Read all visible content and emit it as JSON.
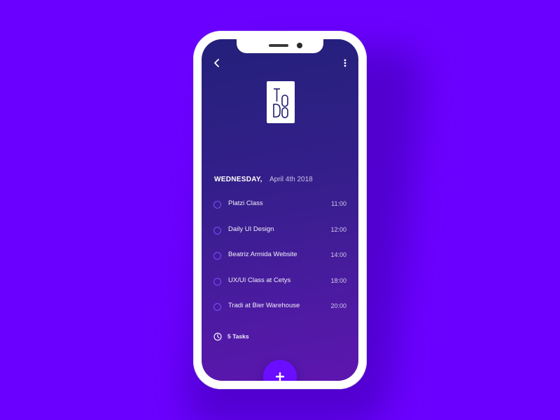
{
  "app": {
    "logo_text": "TODO"
  },
  "header": {
    "day": "WEDNESDAY,",
    "date": "April 4th 2018"
  },
  "tasks": [
    {
      "name": "Platzi Class",
      "time": "11:00"
    },
    {
      "name": "Daily UI Design",
      "time": "12:00"
    },
    {
      "name": "Beatriz Armida Website",
      "time": "14:00"
    },
    {
      "name": "UX/UI Class at Cetys",
      "time": "18:00"
    },
    {
      "name": "Tradi at Bier Warehouse",
      "time": "20:00"
    }
  ],
  "summary": {
    "count_label": "5 Tasks"
  },
  "icons": {
    "back": "chevron-left-icon",
    "menu": "vertical-dots-icon",
    "clock": "clock-icon",
    "add": "plus-icon"
  },
  "colors": {
    "background": "#6a00ff",
    "accent": "#6b0dff",
    "checkbox": "#7c4dff"
  }
}
